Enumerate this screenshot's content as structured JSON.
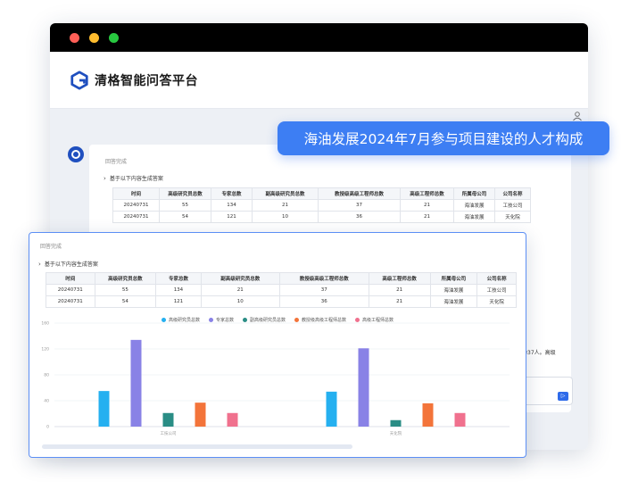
{
  "app": {
    "title": "清格智能问答平台"
  },
  "window_dots": [
    "#ff5f57",
    "#febc2e",
    "#28c840"
  ],
  "question": "海油发展2024年7月参与项目建设的人才构成",
  "answer": {
    "status": "回答完成",
    "toggle_label": "基于以下内容生成答案",
    "table": {
      "headers": [
        "时间",
        "高级研究员总数",
        "专家总数",
        "副高级研究员总数",
        "教授级高级工程师总数",
        "高级工程师总数",
        "所属母公司",
        "公司名称"
      ],
      "rows": [
        [
          "20240731",
          "55",
          "134",
          "21",
          "37",
          "21",
          "海油发展",
          "工技公司"
        ],
        [
          "20240731",
          "54",
          "121",
          "10",
          "36",
          "21",
          "海油发展",
          "天化院"
        ]
      ]
    },
    "partial_text": "为37人。高级"
  },
  "chart_data": {
    "type": "bar",
    "categories": [
      "工技公司",
      "天化院"
    ],
    "series": [
      {
        "name": "高级研究员总数",
        "values": [
          55,
          54
        ],
        "color": "#25b0f0"
      },
      {
        "name": "专家总数",
        "values": [
          134,
          121
        ],
        "color": "#8982e6"
      },
      {
        "name": "副高级研究员总数",
        "values": [
          21,
          10
        ],
        "color": "#2a8d85"
      },
      {
        "name": "教授级高级工程师总数",
        "values": [
          37,
          36
        ],
        "color": "#f3743a"
      },
      {
        "name": "高级工程师总数",
        "values": [
          21,
          21
        ],
        "color": "#f0718e"
      }
    ],
    "yticks": [
      "0",
      "40",
      "80",
      "120",
      "160"
    ],
    "ylim": [
      0,
      160
    ],
    "legend_position": "top"
  },
  "send_label": "▷"
}
